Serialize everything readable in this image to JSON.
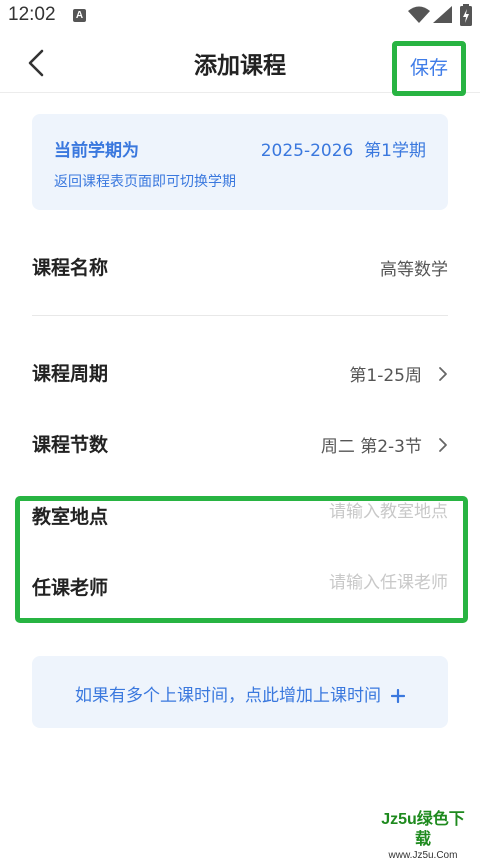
{
  "status_bar": {
    "time": "12:02",
    "notification_badge": "A"
  },
  "header": {
    "title": "添加课程",
    "save_label": "保存"
  },
  "semester": {
    "label": "当前学期为",
    "value": "2025-2026  第1学期",
    "hint": "返回课程表页面即可切换学期"
  },
  "form": {
    "course_name": {
      "label": "课程名称",
      "value": "高等数学"
    },
    "course_weeks": {
      "label": "课程周期",
      "value": "第1-25周"
    },
    "course_periods": {
      "label": "课程节数",
      "value": "周二 第2-3节"
    },
    "classroom": {
      "label": "教室地点",
      "placeholder": "请输入教室地点"
    },
    "teacher": {
      "label": "任课老师",
      "placeholder": "请输入任课老师"
    }
  },
  "add_time": {
    "label": "如果有多个上课时间，点此增加上课时间"
  },
  "watermark": {
    "main": "Jz5u绿色下载",
    "sub": "www.Jz5u.Com"
  },
  "colors": {
    "accent": "#3a78de",
    "highlight": "#28b442",
    "card_bg": "#eef4fc"
  },
  "icons": [
    "back-icon",
    "chevron-right-icon",
    "plus-icon",
    "wifi-icon",
    "signal-icon",
    "battery-icon"
  ]
}
